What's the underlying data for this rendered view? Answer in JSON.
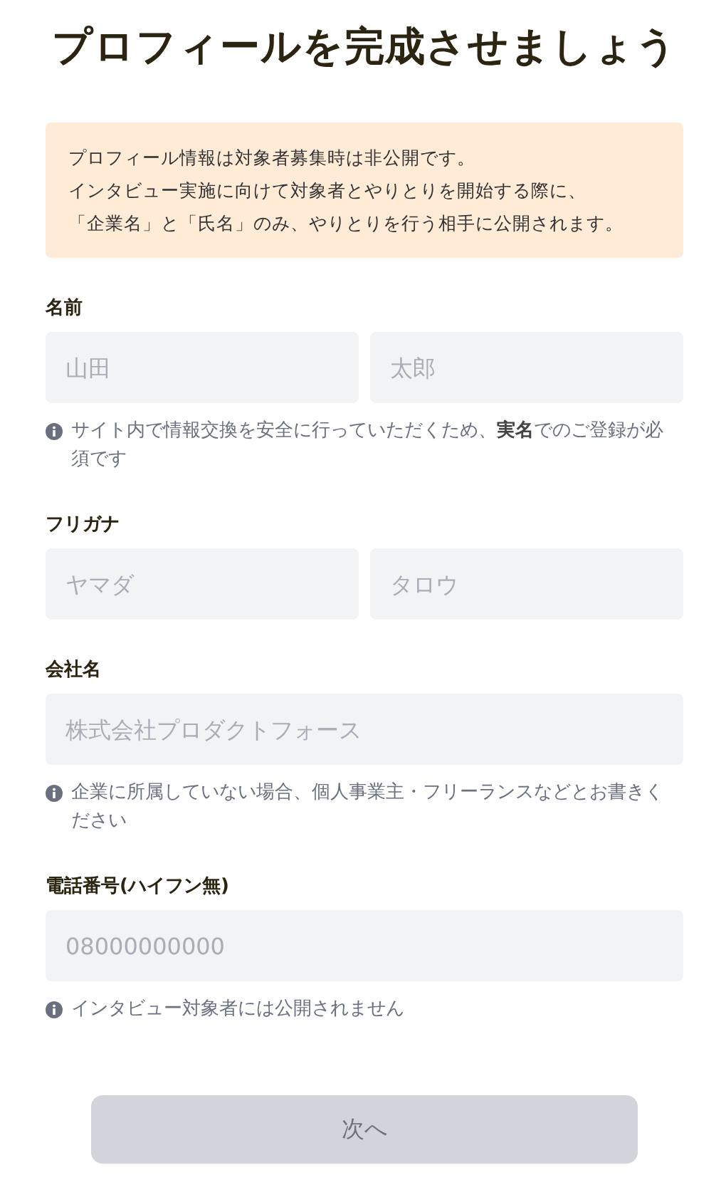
{
  "title": "プロフィールを完成させましょう",
  "notice": [
    "プロフィール情報は対象者募集時は非公開です。",
    "インタビュー実施に向けて対象者とやりとりを開始する際に、",
    "「企業名」と「氏名」のみ、やりとりを行う相手に公開されます。"
  ],
  "fields": [
    {
      "label": "名前",
      "inputs": [
        {
          "placeholder": "山田"
        },
        {
          "placeholder": "太郎"
        }
      ],
      "hint": "サイト内で情報交換を安全に行っていただくため、**実名**でのご登録が必須です"
    },
    {
      "label": "フリガナ",
      "inputs": [
        {
          "placeholder": "ヤマダ"
        },
        {
          "placeholder": "タロウ"
        }
      ]
    },
    {
      "label": "会社名",
      "inputs": [
        {
          "placeholder": "株式会社プロダクトフォース"
        }
      ],
      "hint": "企業に所属していない場合、個人事業主・フリーランスなどとお書きください"
    },
    {
      "label": "電話番号(ハイフン無)",
      "inputs": [
        {
          "placeholder": "08000000000"
        }
      ],
      "hint": "インタビュー対象者には公開されません"
    }
  ],
  "next_button": {
    "label": "次へ",
    "disabled": true
  }
}
